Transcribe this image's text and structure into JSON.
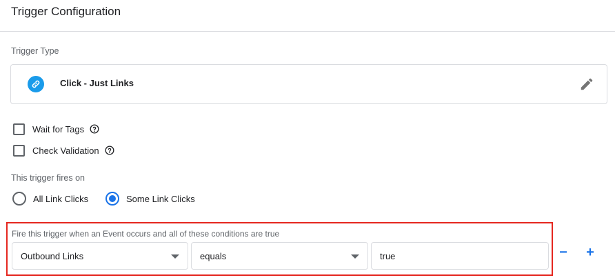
{
  "header": {
    "title": "Trigger Configuration"
  },
  "trigger_type": {
    "label": "Trigger Type",
    "name": "Click - Just Links",
    "icon": "link-icon",
    "icon_color": "#1a9bea"
  },
  "options": {
    "wait_for_tags": {
      "label": "Wait for Tags",
      "checked": false
    },
    "check_validation": {
      "label": "Check Validation",
      "checked": false
    }
  },
  "fires_on": {
    "label": "This trigger fires on",
    "all": {
      "label": "All Link Clicks",
      "selected": false
    },
    "some": {
      "label": "Some Link Clicks",
      "selected": true
    }
  },
  "conditions": {
    "label": "Fire this trigger when an Event occurs and all of these conditions are true",
    "variable": "Outbound Links",
    "operator": "equals",
    "value": "true",
    "remove_label": "−",
    "add_label": "+",
    "highlight_color": "#e5271f"
  }
}
